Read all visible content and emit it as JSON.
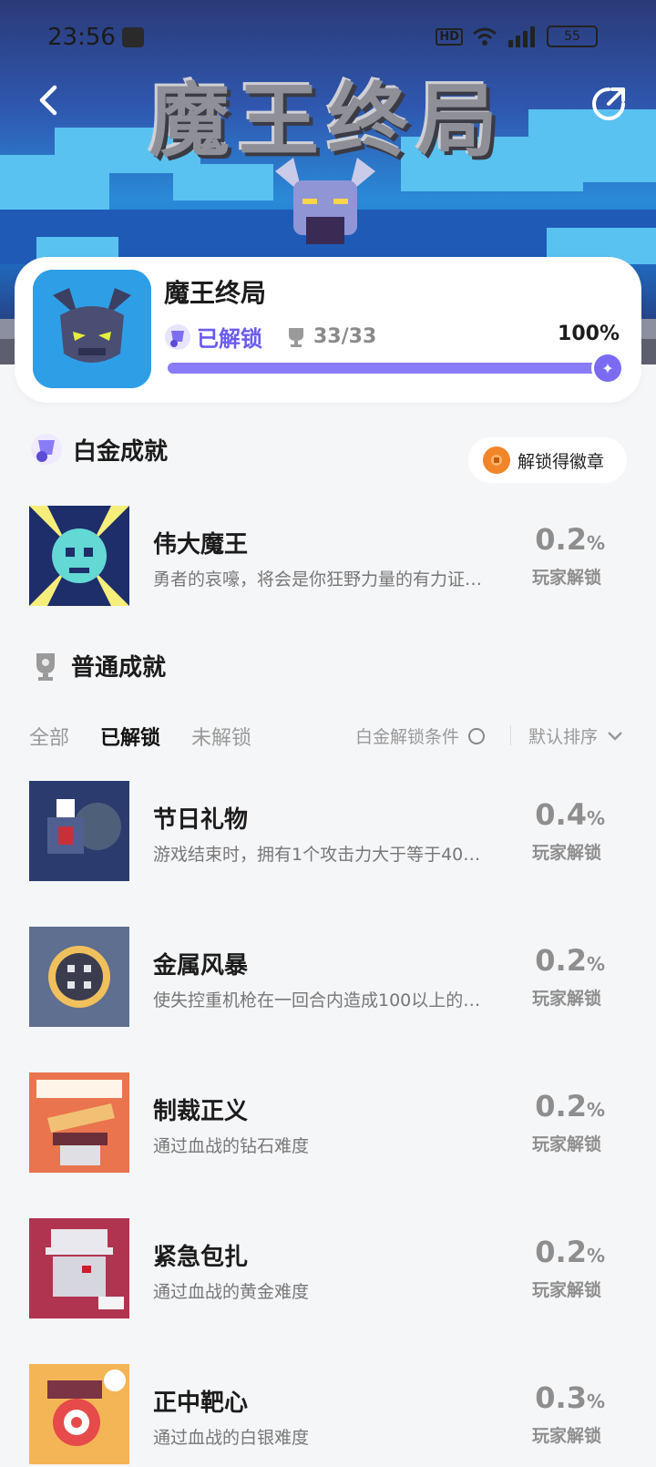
{
  "status_bar": {
    "time": "23:56",
    "battery": "55",
    "network": "5G",
    "hd": "HD"
  },
  "banner": {
    "logo_text": "魔王终局"
  },
  "game": {
    "title": "魔王终局",
    "unlocked_label": "已解锁",
    "trophy_count": "33/33",
    "percent": "100%",
    "progress": 1.0
  },
  "platinum": {
    "title": "白金成就",
    "badge_button": "解锁得徽章",
    "item": {
      "name": "伟大魔王",
      "desc": "勇者的哀嚎，将会是你狂野力量的有力证…",
      "rate": "0.2",
      "unit": "%",
      "rate_label": "玩家解锁"
    }
  },
  "normal": {
    "title": "普通成就",
    "tabs": [
      "全部",
      "已解锁",
      "未解锁"
    ],
    "active_tab": "已解锁",
    "condition_label": "白金解锁条件",
    "sort_label": "默认排序",
    "items": [
      {
        "name": "节日礼物",
        "desc": "游戏结束时，拥有1个攻击力大于等于40…",
        "rate": "0.4",
        "unit": "%",
        "rate_label": "玩家解锁"
      },
      {
        "name": "金属风暴",
        "desc": "使失控重机枪在一回合内造成100以上的…",
        "rate": "0.2",
        "unit": "%",
        "rate_label": "玩家解锁"
      },
      {
        "name": "制裁正义",
        "desc": "通过血战的钻石难度",
        "rate": "0.2",
        "unit": "%",
        "rate_label": "玩家解锁"
      },
      {
        "name": "紧急包扎",
        "desc": "通过血战的黄金难度",
        "rate": "0.2",
        "unit": "%",
        "rate_label": "玩家解锁"
      },
      {
        "name": "正中靶心",
        "desc": "通过血战的白银难度",
        "rate": "0.3",
        "unit": "%",
        "rate_label": "玩家解锁"
      }
    ]
  },
  "colors": {
    "accent": "#6b5cf0",
    "progress": "#8a7cf6",
    "badge": "#f0852a",
    "background": "#f5f6f8"
  },
  "icons": [
    "back-arrow-icon",
    "share-icon",
    "platinum-trophy-icon",
    "trophy-icon",
    "medal-icon",
    "chevron-down-icon",
    "circle-icon"
  ]
}
